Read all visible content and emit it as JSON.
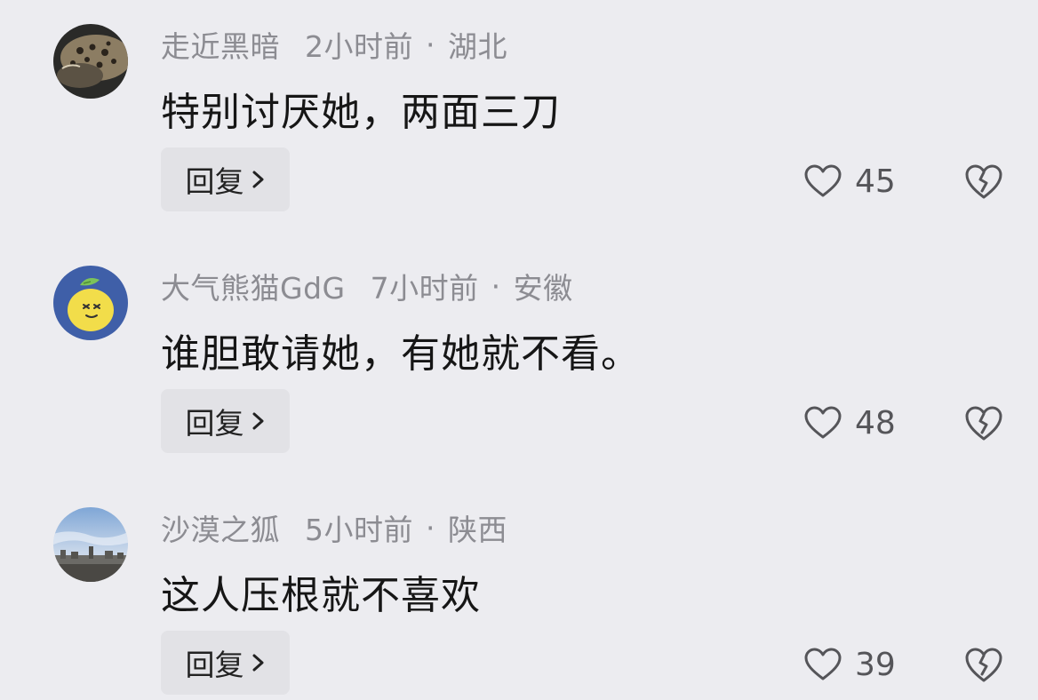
{
  "comments": [
    {
      "username": "走近黑暗",
      "time": "2小时前",
      "separator": "·",
      "location": "湖北",
      "text": "特别讨厌她，两面三刀",
      "reply_label": "回复",
      "likes": "45",
      "avatar": "leopard-photo"
    },
    {
      "username": "大气熊猫GdG",
      "time": "7小时前",
      "separator": "·",
      "location": "安徽",
      "text": "谁胆敢请她，有她就不看。",
      "reply_label": "回复",
      "likes": "48",
      "avatar": "lemon-cartoon"
    },
    {
      "username": "沙漠之狐",
      "time": "5小时前",
      "separator": "·",
      "location": "陕西",
      "text": "这人压根就不喜欢",
      "reply_label": "回复",
      "likes": "39",
      "avatar": "city-skyline-photo"
    }
  ],
  "icons": {
    "like": "heart-outline-icon",
    "dislike": "broken-heart-icon",
    "reply_arrow": "chevron-right-icon"
  },
  "colors": {
    "background": "#ececf0",
    "meta_text": "#8c8c92",
    "body_text": "#161616",
    "reply_bg": "#e2e2e6"
  }
}
